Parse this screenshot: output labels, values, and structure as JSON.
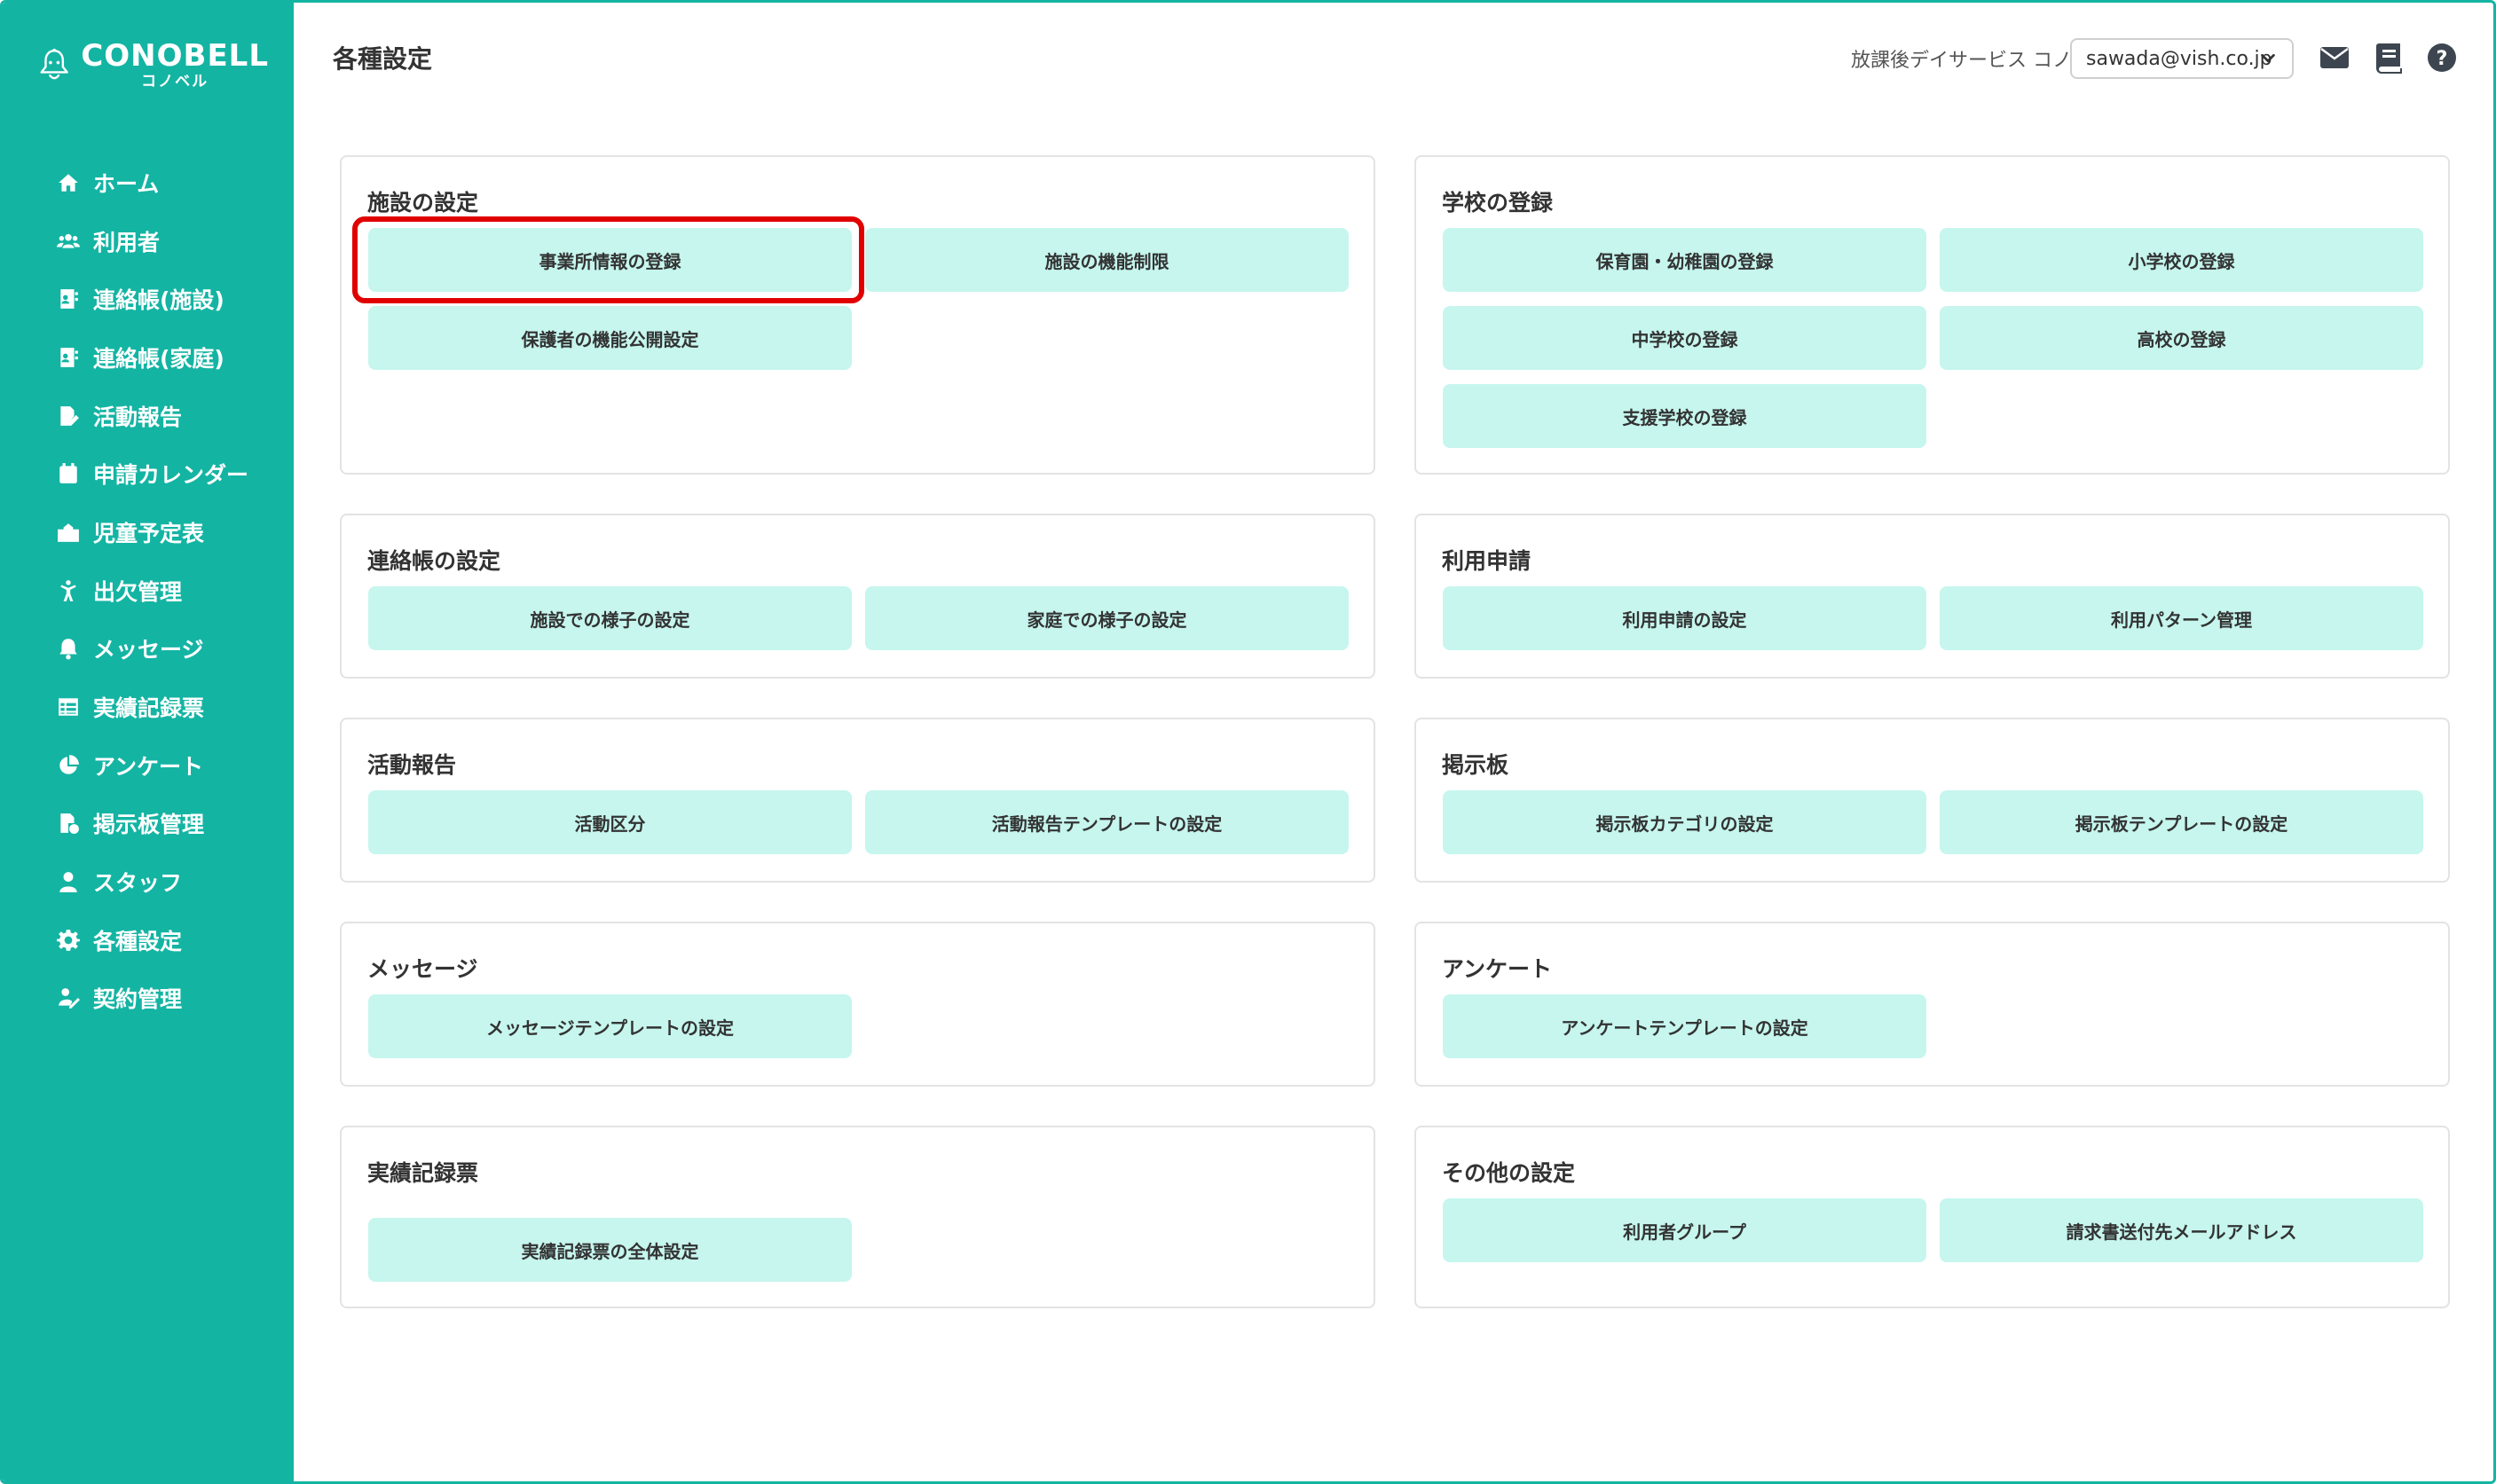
{
  "app": {
    "logo_main": "CONOBELL",
    "logo_sub": "コノベル"
  },
  "sidebar": {
    "items": [
      {
        "label": "ホーム",
        "icon": "home-icon"
      },
      {
        "label": "利用者",
        "icon": "users-icon"
      },
      {
        "label": "連絡帳(施設)",
        "icon": "contact-book-icon"
      },
      {
        "label": "連絡帳(家庭)",
        "icon": "contact-book-icon"
      },
      {
        "label": "活動報告",
        "icon": "report-edit-icon"
      },
      {
        "label": "申請カレンダー",
        "icon": "calendar-icon"
      },
      {
        "label": "児童予定表",
        "icon": "school-icon"
      },
      {
        "label": "出欠管理",
        "icon": "attendance-icon"
      },
      {
        "label": "メッセージ",
        "icon": "bell-icon"
      },
      {
        "label": "実績記録票",
        "icon": "table-icon"
      },
      {
        "label": "アンケート",
        "icon": "pie-chart-icon"
      },
      {
        "label": "掲示板管理",
        "icon": "board-icon"
      },
      {
        "label": "スタッフ",
        "icon": "staff-icon"
      },
      {
        "label": "各種設定",
        "icon": "gear-icon"
      },
      {
        "label": "契約管理",
        "icon": "contract-icon"
      }
    ]
  },
  "header": {
    "title": "各種設定",
    "facility": "放課後デイサービス コノベル",
    "account": "sawada@vish.co.jp",
    "icons": [
      "mail-icon",
      "book-icon",
      "help-icon"
    ]
  },
  "cards": {
    "facility": {
      "title": "施設の設定",
      "buttons": [
        "事業所情報の登録",
        "施設の機能制限",
        "保護者の機能公開設定"
      ]
    },
    "school": {
      "title": "学校の登録",
      "buttons": [
        "保育園・幼稚園の登録",
        "小学校の登録",
        "中学校の登録",
        "高校の登録",
        "支援学校の登録"
      ]
    },
    "contact": {
      "title": "連絡帳の設定",
      "buttons": [
        "施設での様子の設定",
        "家庭での様子の設定"
      ]
    },
    "usage": {
      "title": "利用申請",
      "buttons": [
        "利用申請の設定",
        "利用パターン管理"
      ]
    },
    "activity": {
      "title": "活動報告",
      "buttons": [
        "活動区分",
        "活動報告テンプレートの設定"
      ]
    },
    "board": {
      "title": "掲示板",
      "buttons": [
        "掲示板カテゴリの設定",
        "掲示板テンプレートの設定"
      ]
    },
    "message": {
      "title": "メッセージ",
      "buttons": [
        "メッセージテンプレートの設定"
      ]
    },
    "survey": {
      "title": "アンケート",
      "buttons": [
        "アンケートテンプレートの設定"
      ]
    },
    "record": {
      "title": "実績記録票",
      "buttons": [
        "実績記録票の全体設定"
      ]
    },
    "other": {
      "title": "その他の設定",
      "buttons": [
        "利用者グループ",
        "請求書送付先メールアドレス"
      ]
    }
  },
  "colors": {
    "brand": "#14b4a3",
    "button_bg": "#c6f6ee",
    "highlight": "#e00000"
  }
}
